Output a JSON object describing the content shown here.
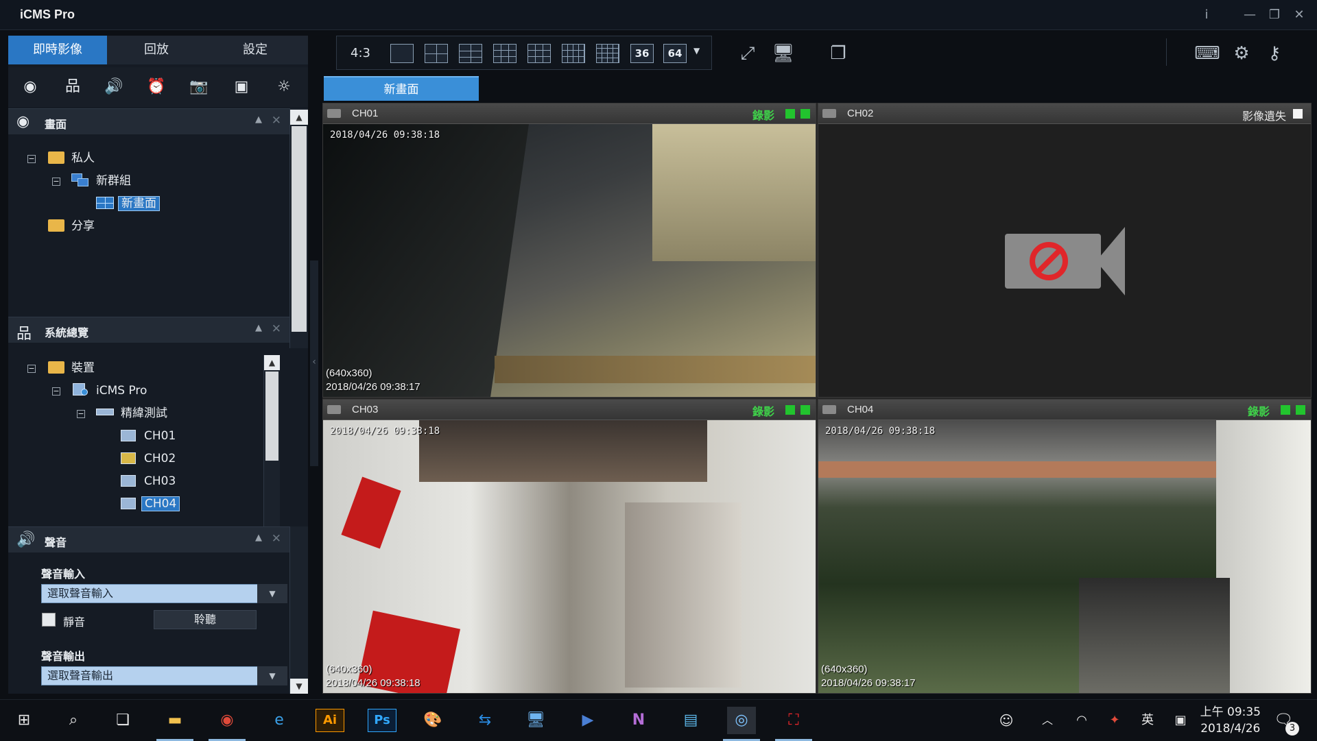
{
  "window": {
    "title": "iCMS Pro",
    "info": "i",
    "minimize": "—",
    "maximize": "❐",
    "close": "✕"
  },
  "left_tabs": [
    "即時影像",
    "回放",
    "設定"
  ],
  "panel_views": {
    "title": "畫面",
    "tree": [
      {
        "label": "私人",
        "level": 0
      },
      {
        "label": "新群組",
        "level": 1
      },
      {
        "label": "新畫面",
        "level": 2,
        "selected": true
      },
      {
        "label": "分享",
        "level": 0
      }
    ]
  },
  "panel_system": {
    "title": "系統總覽",
    "tree": [
      {
        "label": "裝置",
        "level": 0
      },
      {
        "label": "iCMS Pro",
        "level": 1
      },
      {
        "label": "精緯測試",
        "level": 2
      },
      {
        "label": "CH01",
        "level": 3
      },
      {
        "label": "CH02",
        "level": 3
      },
      {
        "label": "CH03",
        "level": 3
      },
      {
        "label": "CH04",
        "level": 3,
        "selected": true
      }
    ]
  },
  "panel_sound": {
    "title": "聲音",
    "input_label": "聲音輸入",
    "input_placeholder": "選取聲音輸入",
    "mute_label": "靜音",
    "listen_label": "聆聽",
    "output_label": "聲音輸出",
    "output_placeholder": "選取聲音輸出"
  },
  "toolbar": {
    "ratio": "4:3",
    "layout_36": "36",
    "layout_64": "64"
  },
  "view_tab": "新畫面",
  "channels": [
    {
      "name": "CH01",
      "status": "錄影",
      "osd_top": "2018/04/26 09:38:18",
      "resolution": "(640x360)",
      "osd_bottom": "2018/04/26 09:38:17"
    },
    {
      "name": "CH02",
      "status": "影像遺失"
    },
    {
      "name": "CH03",
      "status": "錄影",
      "osd_top": "2018/04/26 09:38:18",
      "resolution": "(640x360)",
      "osd_bottom": "2018/04/26 09:38:18"
    },
    {
      "name": "CH04",
      "status": "錄影",
      "osd_top": "2018/04/26 09:38:18",
      "resolution": "(640x360)",
      "osd_bottom": "2018/04/26 09:38:17"
    }
  ],
  "taskbar": {
    "clock_time": "上午 09:35",
    "clock_date": "2018/4/26",
    "ime": "英",
    "notifications": "3",
    "apps": [
      "Ai",
      "Ps",
      "N"
    ]
  },
  "colors": {
    "accent": "#2a77c4",
    "record": "#3fd24a"
  }
}
